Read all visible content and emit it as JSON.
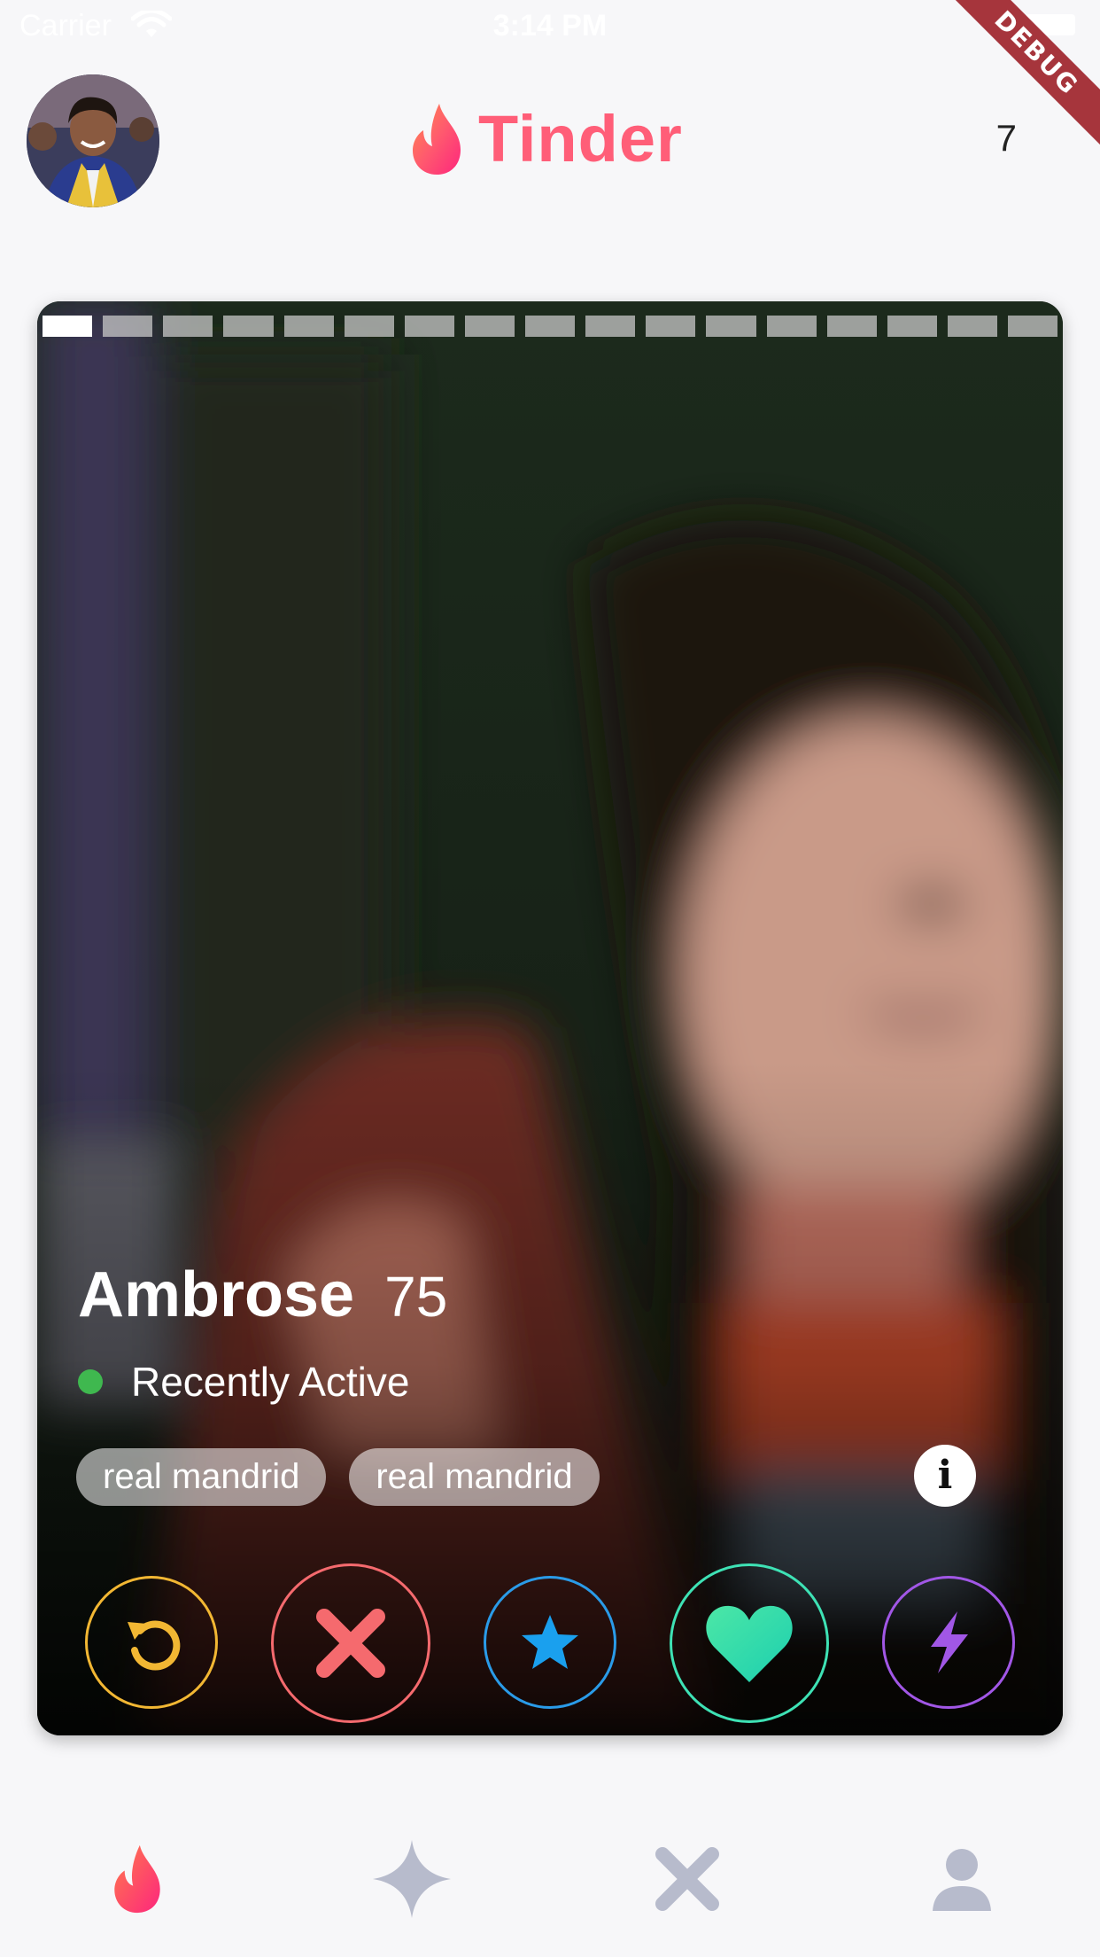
{
  "status_bar": {
    "carrier": "Carrier",
    "time": "3:14 PM"
  },
  "debug_ribbon": "DEBUG",
  "header": {
    "app_name": "Tinder",
    "counter": "7"
  },
  "card": {
    "photo_progress": {
      "total": 17,
      "current": 1
    },
    "name": "Ambrose",
    "age": "75",
    "status": "Recently Active",
    "tags": [
      "real mandrid",
      "real mandrid"
    ],
    "info_glyph": "i"
  },
  "actions": [
    {
      "icon": "undo-icon",
      "color": "#f2b733"
    },
    {
      "icon": "close-icon",
      "color": "#f56a6e"
    },
    {
      "icon": "star-icon",
      "color": "#2a9be8"
    },
    {
      "icon": "heart-icon",
      "color": "#3ee2b5"
    },
    {
      "icon": "lightning-icon",
      "color": "#a157e6"
    }
  ],
  "bottom_nav": {
    "items": [
      {
        "icon": "flame-icon",
        "active": true
      },
      {
        "icon": "sparkle-icon",
        "active": false
      },
      {
        "icon": "close-icon",
        "active": false
      },
      {
        "icon": "profile-icon",
        "active": false
      }
    ],
    "active_color": "#ff4d6d",
    "inactive_color": "#b7bbcc"
  },
  "colors": {
    "brand": "#ff5e78",
    "background": "#f7f7f9",
    "active_dot": "#3fb84f"
  }
}
